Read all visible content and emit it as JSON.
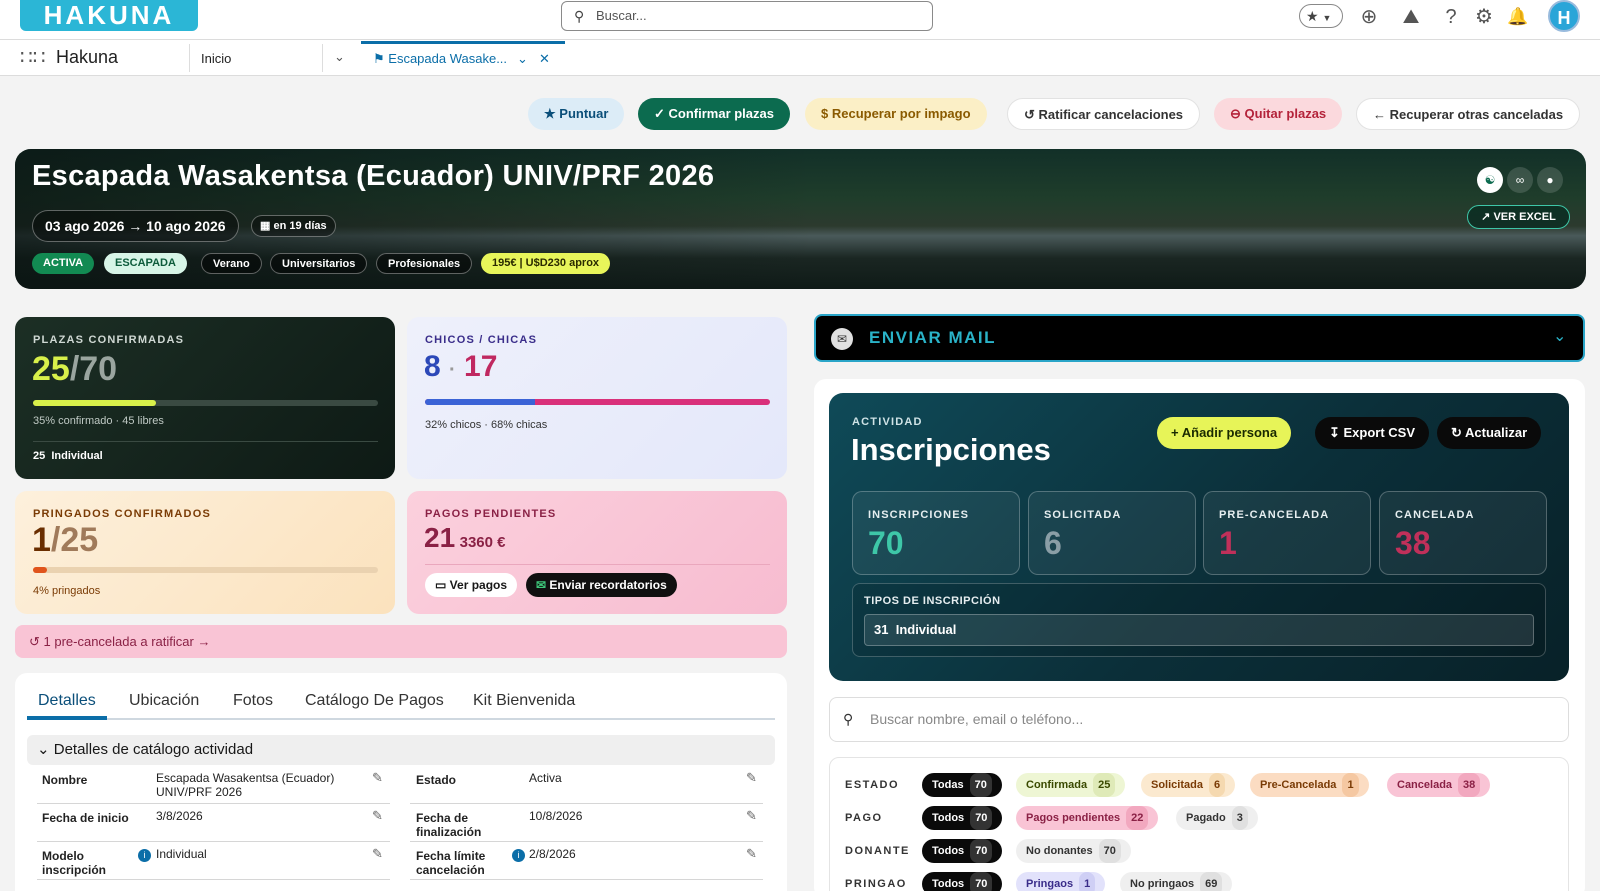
{
  "topbar": {
    "logo": "HAKUNA",
    "search_placeholder": "Buscar...",
    "avatar_initial": "H"
  },
  "nav": {
    "app_name": "Hakuna",
    "home_tab": "Inicio",
    "active_tab": "Escapada Wasake..."
  },
  "actions": {
    "puntuar": "Puntuar",
    "confirmar": "Confirmar plazas",
    "recuperar_impago": "Recuperar por impago",
    "ratificar": "Ratificar cancelaciones",
    "quitar": "Quitar plazas",
    "recuperar_otras": "Recuperar otras canceladas"
  },
  "hero": {
    "title": "Escapada Wasakentsa (Ecuador) UNIV/PRF 2026",
    "dates": "03 ago 2026 → 10 ago 2026",
    "countdown": "en 19 días",
    "tags": [
      "ACTIVA",
      "ESCAPADA",
      "Verano",
      "Universitarios",
      "Profesionales",
      "195€ | U$D230 aprox"
    ],
    "ver_excel": "VER EXCEL"
  },
  "cards": {
    "plazas": {
      "label": "PLAZAS CONFIRMADAS",
      "confirmed": "25",
      "total": "/70",
      "fill": 0.357,
      "caption": "35% confirmado · 45 libres",
      "count": "25",
      "type": "Individual"
    },
    "genero": {
      "label": "CHICOS / CHICAS",
      "chicos": "8",
      "sep": "·",
      "chicas": "17",
      "fill": 0.32,
      "caption": "32% chicos · 68% chicas"
    },
    "pringados": {
      "label": "PRINGADOS CONFIRMADOS",
      "value": "1",
      "total": "/25",
      "fill": 0.04,
      "caption": "4% pringados"
    },
    "pagos": {
      "label": "PAGOS PENDIENTES",
      "count": "21",
      "amount": "3360 €",
      "ver_pagos": "Ver pagos",
      "enviar": "Enviar recordatorios"
    }
  },
  "alert": {
    "text": "1 pre-cancelada a ratificar"
  },
  "detail_tabs": [
    "Detalles",
    "Ubicación",
    "Fotos",
    "Catálogo De Pagos",
    "Kit Bienvenida"
  ],
  "details": {
    "section": "Detalles de catálogo actividad",
    "rows": [
      {
        "l1": "Nombre",
        "v1": "Escapada Wasakentsa (Ecuador) UNIV/PRF 2026",
        "l2": "Estado",
        "v2": "Activa"
      },
      {
        "l1": "Fecha de inicio",
        "v1": "3/8/2026",
        "l2": "Fecha de finalización",
        "v2": "10/8/2026"
      },
      {
        "l1": "Modelo inscripción",
        "v1": "Individual",
        "l2": "Fecha límite cancelación",
        "v2": "2/8/2026"
      }
    ]
  },
  "mail": {
    "title": "ENVIAR MAIL"
  },
  "inscripciones": {
    "eyebrow": "ACTIVIDAD",
    "title": "Inscripciones",
    "add": "Añadir persona",
    "export": "Export CSV",
    "refresh": "Actualizar",
    "stats": [
      {
        "label": "INSCRIPCIONES",
        "value": "70",
        "color": "#3ec7a8"
      },
      {
        "label": "SOLICITADA",
        "value": "6",
        "color": "#8a9ea6"
      },
      {
        "label": "PRE-CANCELADA",
        "value": "1",
        "color": "#c0305a"
      },
      {
        "label": "CANCELADA",
        "value": "38",
        "color": "#c0305a"
      }
    ],
    "tipos_label": "TIPOS DE INSCRIPCIÓN",
    "tipos_count": "31",
    "tipos_name": "Individual"
  },
  "search": {
    "placeholder": "Buscar nombre, email o teléfono..."
  },
  "filters": [
    {
      "label": "ESTADO",
      "chips": [
        {
          "t": "Todas",
          "n": "70"
        },
        {
          "t": "Confirmada",
          "n": "25"
        },
        {
          "t": "Solicitada",
          "n": "6"
        },
        {
          "t": "Pre-Cancelada",
          "n": "1"
        },
        {
          "t": "Cancelada",
          "n": "38"
        }
      ]
    },
    {
      "label": "PAGO",
      "chips": [
        {
          "t": "Todos",
          "n": "70"
        },
        {
          "t": "Pagos pendientes",
          "n": "22"
        },
        {
          "t": "Pagado",
          "n": "3"
        }
      ]
    },
    {
      "label": "DONANTE",
      "chips": [
        {
          "t": "Todos",
          "n": "70"
        },
        {
          "t": "No donantes",
          "n": "70"
        }
      ]
    },
    {
      "label": "PRINGAO",
      "chips": [
        {
          "t": "Todos",
          "n": "70"
        },
        {
          "t": "Pringaos",
          "n": "1"
        },
        {
          "t": "No pringaos",
          "n": "69"
        }
      ]
    }
  ]
}
